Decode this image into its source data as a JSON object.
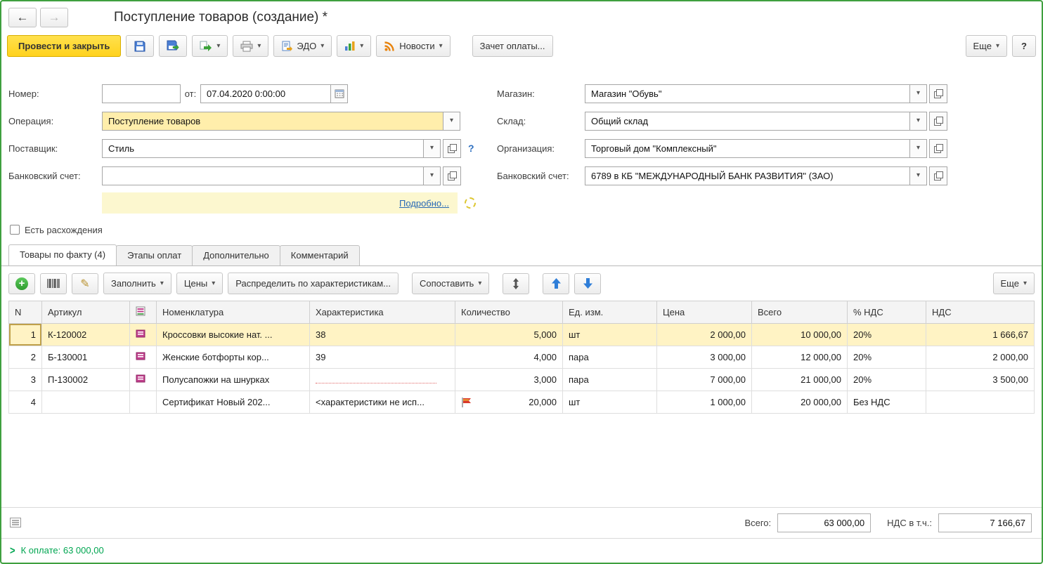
{
  "window": {
    "title": "Поступление товаров (создание) *"
  },
  "icons": {
    "back": "←",
    "forward": "→",
    "caret": "▾",
    "pencil": "✎",
    "plus": "+",
    "question": "?",
    "chevron": ">"
  },
  "toolbar": {
    "post_and_close": "Провести и закрыть",
    "edo": "ЭДО",
    "news": "Новости",
    "payment_offset": "Зачет оплаты...",
    "more": "Еще",
    "help": "?"
  },
  "fields": {
    "number": {
      "label": "Номер:",
      "value": ""
    },
    "date": {
      "label": "от:",
      "value": "07.04.2020 0:00:00"
    },
    "operation": {
      "label": "Операция:",
      "value": "Поступление товаров"
    },
    "supplier": {
      "label": "Поставщик:",
      "value": "Стиль"
    },
    "bank_account_left": {
      "label": "Банковский счет:",
      "value": ""
    },
    "store": {
      "label": "Магазин:",
      "value": "Магазин \"Обувь\""
    },
    "warehouse": {
      "label": "Склад:",
      "value": "Общий склад"
    },
    "organization": {
      "label": "Организация:",
      "value": "Торговый дом \"Комплексный\""
    },
    "bank_account_right": {
      "label": "Банковский счет:",
      "value": "6789 в КБ \"МЕЖДУНАРОДНЫЙ БАНК РАЗВИТИЯ\" (ЗАО)"
    },
    "details_link": "Подробно...",
    "discrepancies_label": "Есть расхождения"
  },
  "tabs": [
    {
      "label": "Товары по факту (4)",
      "active": true
    },
    {
      "label": "Этапы оплат",
      "active": false
    },
    {
      "label": "Дополнительно",
      "active": false
    },
    {
      "label": "Комментарий",
      "active": false
    }
  ],
  "table_toolbar": {
    "fill": "Заполнить",
    "prices": "Цены",
    "distribute": "Распределить по характеристикам...",
    "match": "Сопоставить",
    "more": "Еще"
  },
  "table": {
    "headers": [
      "N",
      "Артикул",
      "",
      "Номенклатура",
      "Характеристика",
      "Количество",
      "Ед. изм.",
      "Цена",
      "Всего",
      "% НДС",
      "НДС"
    ],
    "rows": [
      {
        "n": "1",
        "article": "К-120002",
        "name": "Кроссовки высокие нат. ...",
        "characteristic": "38",
        "qty": "5,000",
        "unit": "шт",
        "price": "2 000,00",
        "total": "10 000,00",
        "vat_rate": "20%",
        "vat_sum": "1 666,67"
      },
      {
        "n": "2",
        "article": "Б-130001",
        "name": "Женские ботфорты кор...",
        "characteristic": "39",
        "qty": "4,000",
        "unit": "пара",
        "price": "3 000,00",
        "total": "12 000,00",
        "vat_rate": "20%",
        "vat_sum": "2 000,00"
      },
      {
        "n": "3",
        "article": "П-130002",
        "name": "Полусапожки на шнурках",
        "characteristic": "",
        "qty": "3,000",
        "unit": "пара",
        "price": "7 000,00",
        "total": "21 000,00",
        "vat_rate": "20%",
        "vat_sum": "3 500,00"
      },
      {
        "n": "4",
        "article": "",
        "name": "Сертификат Новый 202...",
        "characteristic": "<характеристики не исп...",
        "qty": "20,000",
        "unit": "шт",
        "price": "1 000,00",
        "total": "20 000,00",
        "vat_rate": "Без НДС",
        "vat_sum": ""
      }
    ]
  },
  "totals": {
    "total_label": "Всего:",
    "total_value": "63 000,00",
    "vat_label": "НДС в т.ч.:",
    "vat_value": "7 166,67"
  },
  "footer": {
    "payment": "К оплате: 63 000,00"
  },
  "colors": {
    "window_border": "#3fa03f",
    "primary_button": "#ffd21e",
    "highlight_input": "#ffeeab",
    "selected_row": "#fff3c4",
    "payment_green": "#00a651",
    "link_blue": "#2768b5"
  }
}
